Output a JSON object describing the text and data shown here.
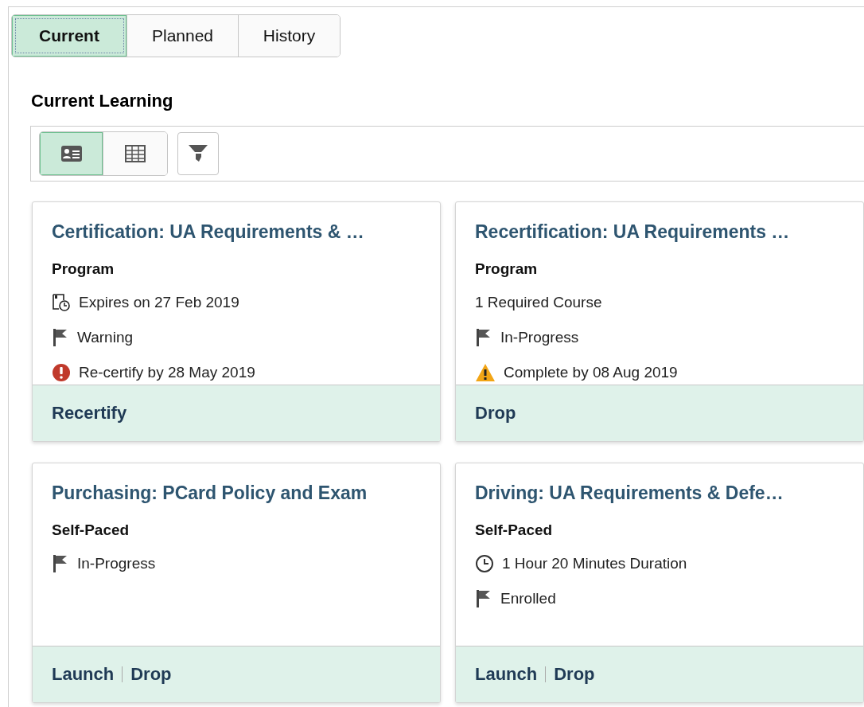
{
  "tabs": [
    {
      "label": "Current",
      "selected": true
    },
    {
      "label": "Planned",
      "selected": false
    },
    {
      "label": "History",
      "selected": false
    }
  ],
  "heading": "Current Learning",
  "view_toggle": [
    {
      "kind": "cards",
      "selected": true
    },
    {
      "kind": "grid",
      "selected": false
    }
  ],
  "cards": [
    {
      "title": "Certification: UA Requirements & …",
      "type": "Program",
      "rows": [
        {
          "kind": "expiry",
          "text": "Expires on 27 Feb 2019"
        },
        {
          "kind": "flag",
          "text": "Warning"
        },
        {
          "kind": "error",
          "text": "Re-certify by 28 May 2019"
        }
      ],
      "actions": [
        "Recertify"
      ]
    },
    {
      "title": "Recertification: UA Requirements …",
      "type": "Program",
      "rows": [
        {
          "kind": "plain",
          "text": "1 Required Course"
        },
        {
          "kind": "flag",
          "text": "In-Progress"
        },
        {
          "kind": "warning",
          "text": "Complete by 08 Aug 2019"
        }
      ],
      "actions": [
        "Drop"
      ]
    },
    {
      "title": "Purchasing: PCard Policy and Exam",
      "type": "Self-Paced",
      "rows": [
        {
          "kind": "flag",
          "text": "In-Progress"
        }
      ],
      "actions": [
        "Launch",
        "Drop"
      ]
    },
    {
      "title": "Driving: UA Requirements & Defe…",
      "type": "Self-Paced",
      "rows": [
        {
          "kind": "clock",
          "text": "1 Hour 20 Minutes Duration"
        },
        {
          "kind": "flag",
          "text": "Enrolled"
        }
      ],
      "actions": [
        "Launch",
        "Drop"
      ]
    }
  ]
}
